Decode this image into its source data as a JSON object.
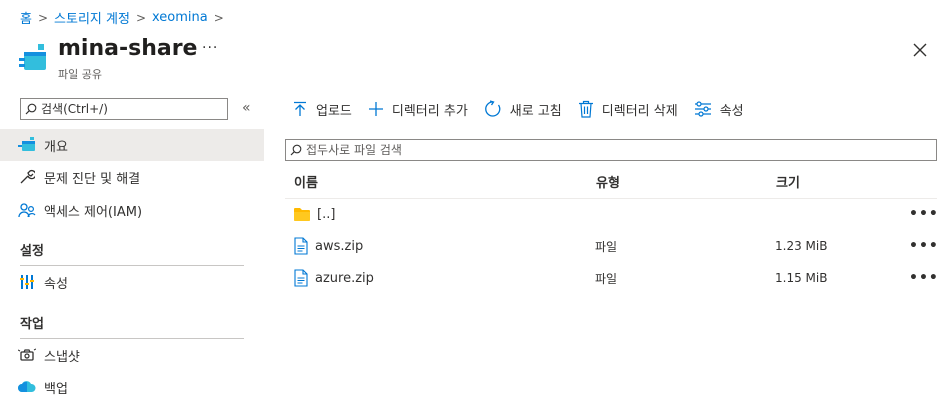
{
  "breadcrumb": [
    "홈",
    "스토리지 계정",
    "xeomina"
  ],
  "header": {
    "title": "mina-share",
    "subtitle": "파일 공유",
    "more": "···"
  },
  "sidebar": {
    "search_placeholder": "검색(Ctrl+/)",
    "collapse": "«",
    "items": [
      {
        "label": "개요",
        "icon": "file-share-icon"
      },
      {
        "label": "문제 진단 및 해결",
        "icon": "wrench-icon"
      },
      {
        "label": "액세스 제어(IAM)",
        "icon": "people-icon"
      }
    ],
    "sections": [
      {
        "heading": "설정",
        "items": [
          {
            "label": "속성",
            "icon": "properties-icon"
          }
        ]
      },
      {
        "heading": "작업",
        "items": [
          {
            "label": "스냅샷",
            "icon": "snapshot-icon"
          },
          {
            "label": "백업",
            "icon": "backup-icon"
          }
        ]
      }
    ]
  },
  "toolbar": [
    {
      "label": "업로드",
      "icon": "upload-icon"
    },
    {
      "label": "디렉터리 추가",
      "icon": "plus-icon"
    },
    {
      "label": "새로 고침",
      "icon": "refresh-icon"
    },
    {
      "label": "디렉터리 삭제",
      "icon": "trash-icon"
    },
    {
      "label": "속성",
      "icon": "properties-icon"
    }
  ],
  "file_search_placeholder": "접두사로 파일 검색",
  "table": {
    "columns": [
      "이름",
      "유형",
      "크기"
    ],
    "rows": [
      {
        "name": "[..]",
        "type": "",
        "size": "",
        "icon": "folder-icon",
        "more": "•••"
      },
      {
        "name": "aws.zip",
        "type": "파일",
        "size": "1.23 MiB",
        "icon": "file-icon",
        "more": "•••"
      },
      {
        "name": "azure.zip",
        "type": "파일",
        "size": "1.15 MiB",
        "icon": "file-icon",
        "more": "•••"
      }
    ]
  },
  "colors": {
    "accent": "#0078d4",
    "folder": "#ffb900",
    "active_bg": "#edebe9"
  }
}
